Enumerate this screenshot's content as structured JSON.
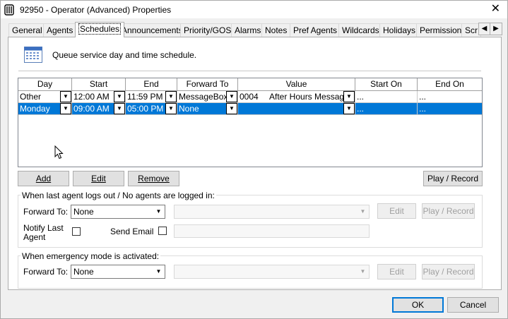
{
  "window": {
    "title": "92950 - Operator (Advanced) Properties"
  },
  "tabs": [
    {
      "label": "General"
    },
    {
      "label": "Agents"
    },
    {
      "label": "Schedules"
    },
    {
      "label": "Announcements"
    },
    {
      "label": "Priority/GOS"
    },
    {
      "label": "Alarms"
    },
    {
      "label": "Notes"
    },
    {
      "label": "Pref Agents"
    },
    {
      "label": "Wildcards"
    },
    {
      "label": "Holidays"
    },
    {
      "label": "Permissions"
    },
    {
      "label": "Scr"
    }
  ],
  "selected_tab": "Schedules",
  "page": {
    "description": "Queue service day and time schedule.",
    "grid": {
      "headers": [
        "Day",
        "Start",
        "End",
        "Forward To",
        "Value",
        "Start On",
        "End On"
      ],
      "rows": [
        {
          "day": "Other",
          "start": "12:00 AM",
          "end": "11:59 PM",
          "forward_to": "MessageBox",
          "value_code": "0004",
          "value_name": "After Hours Message",
          "start_on": "...",
          "end_on": "..."
        },
        {
          "day": "Monday",
          "start": "09:00 AM",
          "end": "05:00 PM",
          "forward_to": "None",
          "value_code": "",
          "value_name": "",
          "start_on": "...",
          "end_on": "..."
        }
      ],
      "selected_row": 1
    },
    "buttons": {
      "add": "Add",
      "edit": "Edit",
      "remove": "Remove",
      "play_record": "Play / Record"
    },
    "last_agent_group": {
      "title": "When last agent logs out / No agents are logged in:",
      "forward_to_label": "Forward To:",
      "forward_to_value": "None",
      "edit_label": "Edit",
      "play_record_label": "Play / Record",
      "notify_label_line1": "Notify Last",
      "notify_label_line2": "Agent",
      "send_email_label": "Send Email"
    },
    "emergency_group": {
      "title": "When emergency mode is activated:",
      "forward_to_label": "Forward To:",
      "forward_to_value": "None",
      "edit_label": "Edit",
      "play_record_label": "Play / Record"
    }
  },
  "footer": {
    "ok": "OK",
    "cancel": "Cancel"
  },
  "colors": {
    "selection": "#0078d7",
    "window_bg": "#f0f0f0",
    "default_button_border": "#0078d7"
  },
  "icons": {
    "app": "phone-app-icon",
    "close": "close-icon",
    "calendar": "calendar-icon",
    "cursor": "mouse-cursor-icon"
  }
}
